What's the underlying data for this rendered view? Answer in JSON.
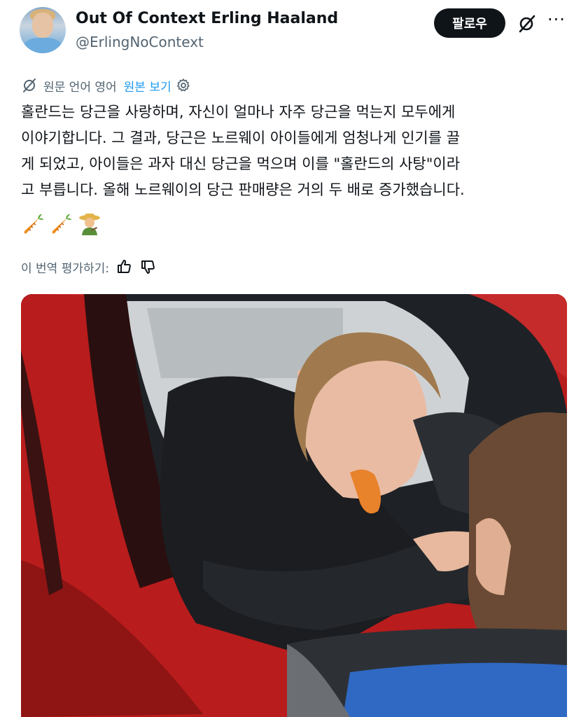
{
  "author": {
    "display_name": "Out Of Context Erling Haaland",
    "handle": "@ErlingNoContext"
  },
  "actions": {
    "follow_label": "팔로우",
    "more_label": "···"
  },
  "translation": {
    "source_language": "원문 언어 영어",
    "show_original": "원본 보기"
  },
  "tweet": {
    "text": "홀란드는 당근을 사랑하며, 자신이 얼마나 자주 당근을 먹는지 모두에게\n이야기합니다. 그 결과, 당근은 노르웨이 아이들에게 엄청나게 인기를 끌\n게 되었고, 아이들은 과자 대신 당근을 먹으며 이를 \"홀란드의 사탕\"이라\n고 부릅니다. 올해 노르웨이의 당근 판매량은 거의 두 배로 증가했습니다.",
    "emojis": [
      "carrot-icon",
      "carrot-icon",
      "farmer-icon"
    ]
  },
  "rate": {
    "label": "이 번역 평가하기:"
  },
  "colors": {
    "text": "#0f1419",
    "secondary": "#536471",
    "link": "#1d9bf0",
    "follow_bg": "#0f1419",
    "car_red": "#c41e1e"
  }
}
